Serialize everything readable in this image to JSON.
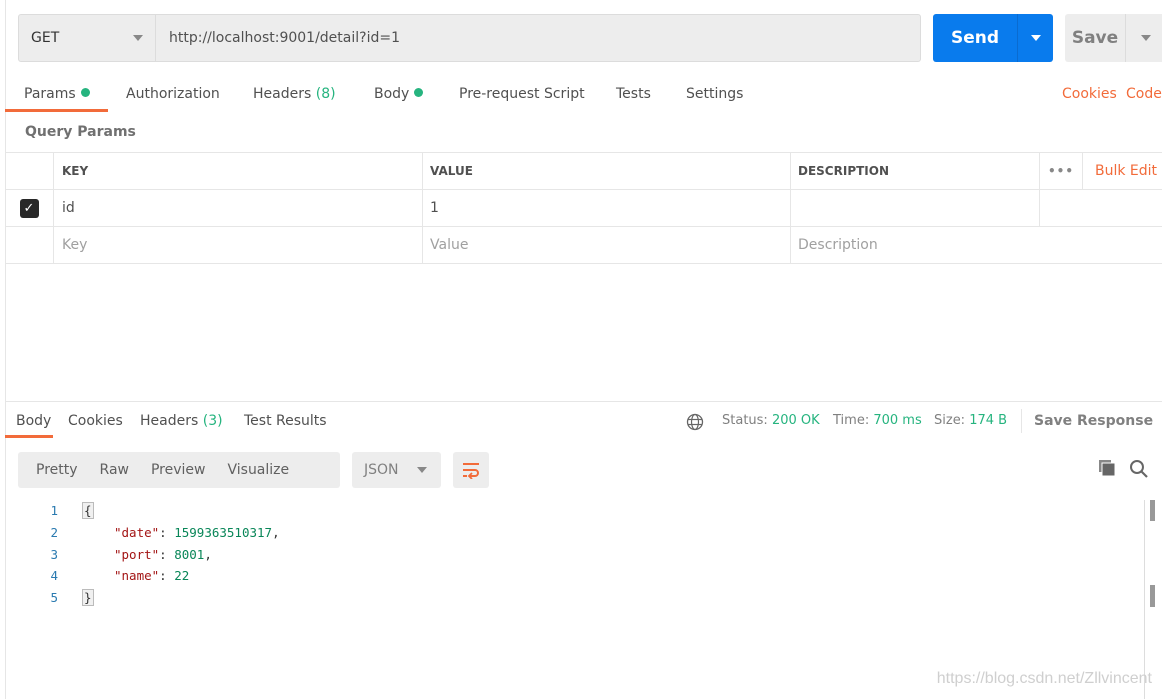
{
  "request": {
    "method": "GET",
    "url": "http://localhost:9001/detail?id=1",
    "send_label": "Send",
    "save_label": "Save"
  },
  "request_tabs": [
    {
      "label": "Params",
      "dot": true
    },
    {
      "label": "Authorization"
    },
    {
      "label": "Headers",
      "count": "(8)"
    },
    {
      "label": "Body",
      "dot": true
    },
    {
      "label": "Pre-request Script"
    },
    {
      "label": "Tests"
    },
    {
      "label": "Settings"
    }
  ],
  "request_links": {
    "cookies": "Cookies",
    "code": "Code"
  },
  "query_params": {
    "title": "Query Params",
    "headers": {
      "key": "KEY",
      "value": "VALUE",
      "description": "DESCRIPTION",
      "more": "•••",
      "bulk_edit": "Bulk Edit"
    },
    "rows": [
      {
        "checked": true,
        "key": "id",
        "value": "1",
        "description": ""
      }
    ],
    "placeholders": {
      "key": "Key",
      "value": "Value",
      "description": "Description"
    }
  },
  "response_tabs": [
    {
      "label": "Body"
    },
    {
      "label": "Cookies"
    },
    {
      "label": "Headers",
      "count": "(3)"
    },
    {
      "label": "Test Results"
    }
  ],
  "status": {
    "status_label": "Status:",
    "status": "200 OK",
    "time_label": "Time:",
    "time": "700 ms",
    "size_label": "Size:",
    "size": "174 B",
    "save_response": "Save Response"
  },
  "view_modes": [
    "Pretty",
    "Raw",
    "Preview",
    "Visualize"
  ],
  "format": "JSON",
  "code_lines": [
    {
      "n": "1",
      "open": "{"
    },
    {
      "n": "2",
      "key": "\"date\"",
      "val": "1599363510317",
      "end": ","
    },
    {
      "n": "3",
      "key": "\"port\"",
      "val": "8001",
      "end": ","
    },
    {
      "n": "4",
      "key": "\"name\"",
      "val": "22",
      "end": ""
    },
    {
      "n": "5",
      "close": "}"
    }
  ],
  "watermark": "https://blog.csdn.net/Zllvincent",
  "colors": {
    "accent": "#f26b3a",
    "send": "#097bed",
    "success": "#26b47f"
  }
}
